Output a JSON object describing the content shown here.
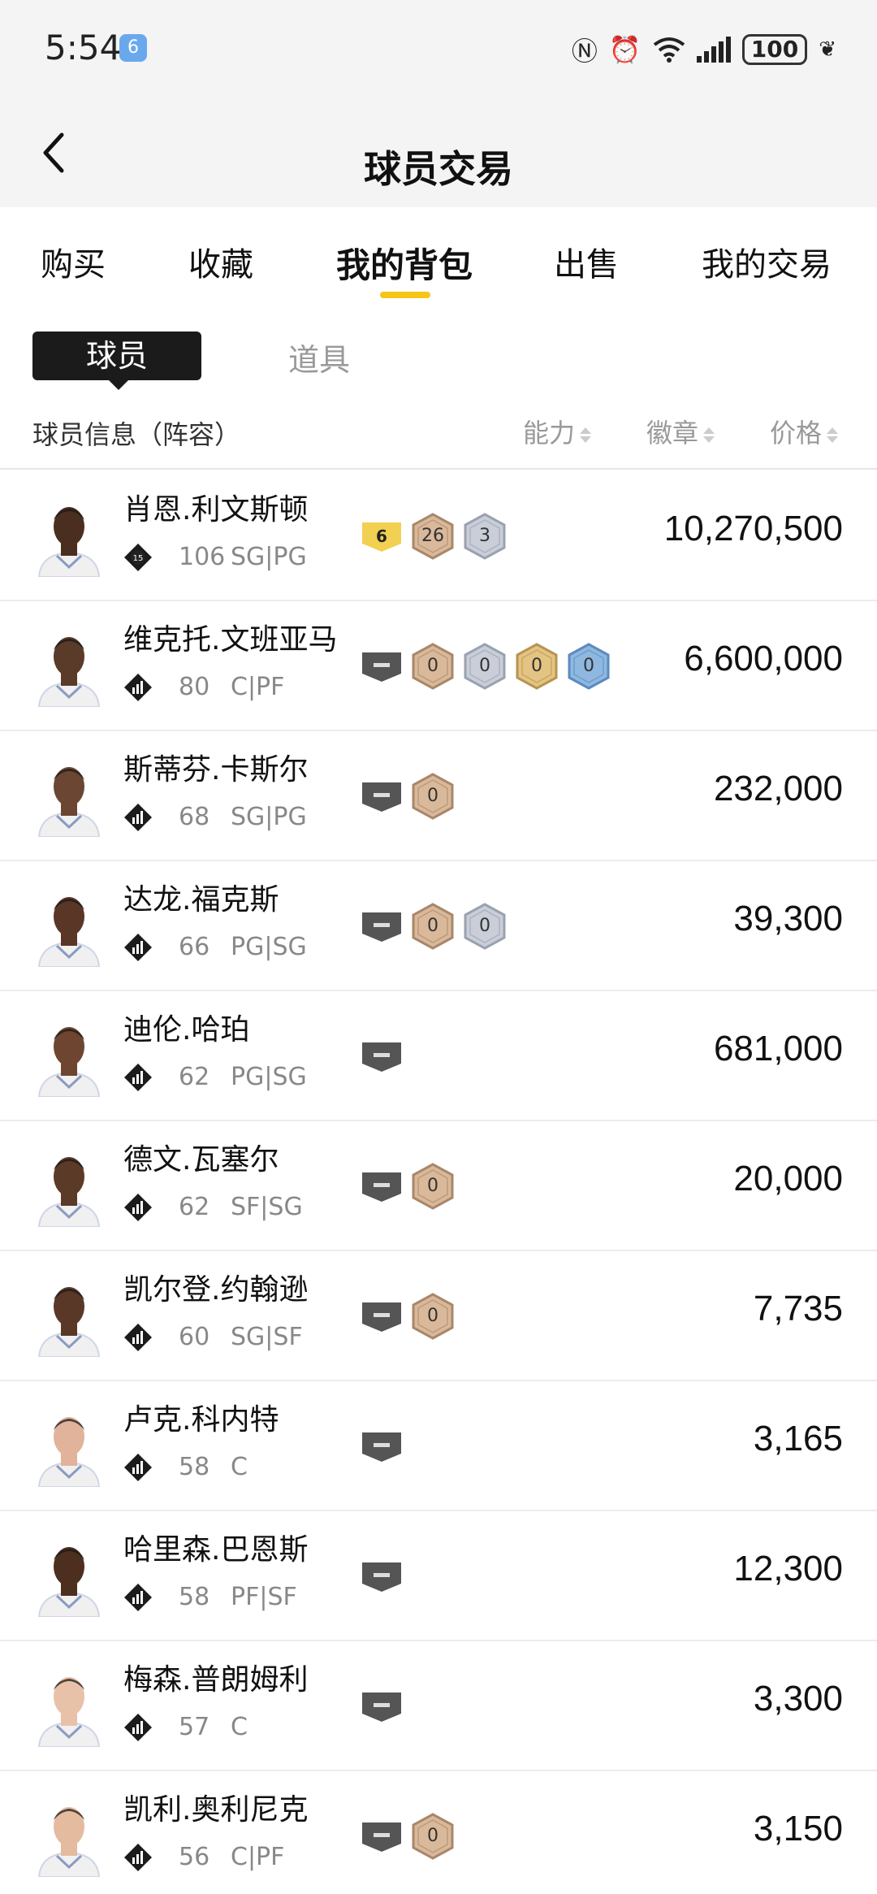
{
  "status": {
    "time": "5:54",
    "notif": "6",
    "battery": "100"
  },
  "title": "球员交易",
  "tabs": [
    {
      "label": "购买"
    },
    {
      "label": "收藏"
    },
    {
      "label": "我的背包"
    },
    {
      "label": "出售"
    },
    {
      "label": "我的交易"
    }
  ],
  "subtabs": {
    "players": "球员",
    "items": "道具"
  },
  "columns": {
    "info": "球员信息（阵容）",
    "ability": "能力",
    "badges": "徽章",
    "price": "价格"
  },
  "players": [
    {
      "name": "肖恩.利文斯顿",
      "rating": "106",
      "pos": "SG|PG",
      "rating_badge": "15",
      "badges": [
        {
          "type": "gold-flag",
          "value": "6"
        },
        {
          "type": "bronze",
          "value": "26"
        },
        {
          "type": "silver",
          "value": "3"
        }
      ],
      "price": "10,270,500",
      "skin": "#4a2e1f"
    },
    {
      "name": "维克托.文班亚马",
      "rating": "80",
      "pos": "C|PF",
      "badges": [
        {
          "type": "grey-flag"
        },
        {
          "type": "bronze",
          "value": "0"
        },
        {
          "type": "silver",
          "value": "0"
        },
        {
          "type": "gold",
          "value": "0"
        },
        {
          "type": "blue",
          "value": "0"
        }
      ],
      "price": "6,600,000",
      "skin": "#5a3a28"
    },
    {
      "name": "斯蒂芬.卡斯尔",
      "rating": "68",
      "pos": "SG|PG",
      "badges": [
        {
          "type": "grey-flag"
        },
        {
          "type": "bronze",
          "value": "0"
        }
      ],
      "price": "232,000",
      "skin": "#6b4632"
    },
    {
      "name": "达龙.福克斯",
      "rating": "66",
      "pos": "PG|SG",
      "badges": [
        {
          "type": "grey-flag"
        },
        {
          "type": "bronze",
          "value": "0"
        },
        {
          "type": "silver",
          "value": "0"
        }
      ],
      "price": "39,300",
      "skin": "#5a3626"
    },
    {
      "name": "迪伦.哈珀",
      "rating": "62",
      "pos": "PG|SG",
      "badges": [
        {
          "type": "grey-flag"
        }
      ],
      "price": "681,000",
      "skin": "#6e4530"
    },
    {
      "name": "德文.瓦塞尔",
      "rating": "62",
      "pos": "SF|SG",
      "badges": [
        {
          "type": "grey-flag"
        },
        {
          "type": "bronze",
          "value": "0"
        }
      ],
      "price": "20,000",
      "skin": "#5c3a28"
    },
    {
      "name": "凯尔登.约翰逊",
      "rating": "60",
      "pos": "SG|SF",
      "badges": [
        {
          "type": "grey-flag"
        },
        {
          "type": "bronze",
          "value": "0"
        }
      ],
      "price": "7,735",
      "skin": "#5a3828"
    },
    {
      "name": "卢克.科内特",
      "rating": "58",
      "pos": "C",
      "badges": [
        {
          "type": "grey-flag"
        }
      ],
      "price": "3,165",
      "skin": "#e0b39a"
    },
    {
      "name": "哈里森.巴恩斯",
      "rating": "58",
      "pos": "PF|SF",
      "badges": [
        {
          "type": "grey-flag"
        }
      ],
      "price": "12,300",
      "skin": "#4d2f20"
    },
    {
      "name": "梅森.普朗姆利",
      "rating": "57",
      "pos": "C",
      "badges": [
        {
          "type": "grey-flag"
        }
      ],
      "price": "3,300",
      "skin": "#e8c2a8"
    },
    {
      "name": "凯利.奥利尼克",
      "rating": "56",
      "pos": "C|PF",
      "badges": [
        {
          "type": "grey-flag"
        },
        {
          "type": "bronze",
          "value": "0"
        }
      ],
      "price": "3,150",
      "skin": "#e4bb9f"
    }
  ]
}
